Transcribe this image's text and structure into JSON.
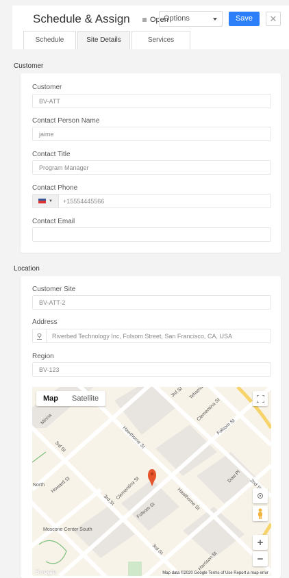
{
  "header": {
    "title": "Schedule & Assign",
    "status_label": "Open",
    "options_value": "Options",
    "save_label": "Save",
    "close_glyph": "✕"
  },
  "tabs": [
    {
      "label": "Schedule",
      "active": false
    },
    {
      "label": "Site Details",
      "active": true
    },
    {
      "label": "Services",
      "active": false
    }
  ],
  "customer_section": {
    "title": "Customer",
    "customer": {
      "label": "Customer",
      "value": "BV-ATT"
    },
    "contact_name": {
      "label": "Contact Person Name",
      "value": "jaime"
    },
    "contact_title": {
      "label": "Contact Title",
      "value": "Program Manager"
    },
    "contact_phone": {
      "label": "Contact Phone",
      "value": "+15554445566",
      "flag_icon": "us-flag-icon"
    },
    "contact_email": {
      "label": "Contact Email",
      "value": ""
    }
  },
  "location_section": {
    "title": "Location",
    "customer_site": {
      "label": "Customer Site",
      "value": "BV-ATT-2"
    },
    "address": {
      "label": "Address",
      "value": "Riverbed Technology Inc, Folsom Street, San Francisco, CA, USA",
      "icon": "location-pin-icon"
    },
    "region": {
      "label": "Region",
      "value": "BV-123"
    }
  },
  "map": {
    "toggle_map": "Map",
    "toggle_satellite": "Satellite",
    "footer": "Map data ©2020 Google   Terms of Use   Report a map error",
    "logo": "Google",
    "zoom_in": "+",
    "zoom_out": "−",
    "labels": {
      "third_st_top": "3rd St",
      "minna": "Minna",
      "tehama": "Tehama",
      "clementina_top": "Clementina St",
      "folsom_top": "Folsom St",
      "hawthorne_top": "Hawthorne St",
      "second_st": "2nd St",
      "third_st_left": "3rd St",
      "howard": "Howard St",
      "north": "North",
      "third_st_mid": "3rd St",
      "clementina_mid": "Clementina St",
      "folsom_mid": "Folsom St",
      "hawthorne_mid": "Hawthorne St",
      "dow_pl": "Dow Pl",
      "moscone": "Moscone Center South",
      "third_st_bottom": "3rd St",
      "harrison": "Harrison St"
    },
    "colors": {
      "accent": "#2d7ff9",
      "marker": "#e5532b",
      "road": "#ffffff",
      "highway": "#f6d36b"
    }
  }
}
